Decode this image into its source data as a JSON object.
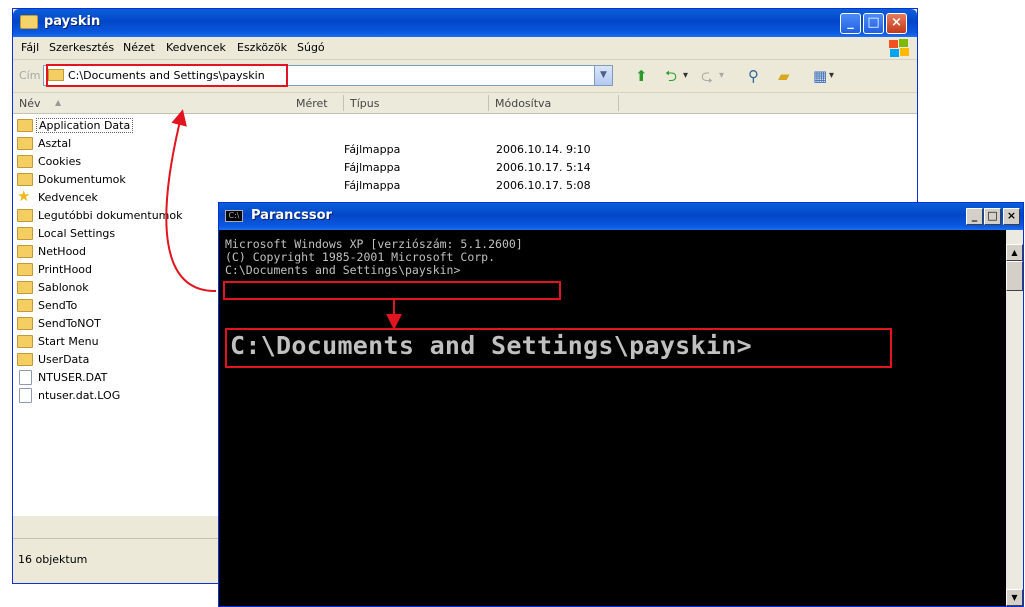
{
  "explorer": {
    "title": "payskin",
    "menu": [
      "Fájl",
      "Szerkesztés",
      "Nézet",
      "Kedvencek",
      "Eszközök",
      "Súgó"
    ],
    "address_label": "Cím",
    "address_value": "C:\\Documents and Settings\\payskin",
    "columns": {
      "name": "Név",
      "size": "Méret",
      "type": "Típus",
      "modified": "Módosítva"
    },
    "files": [
      {
        "name": "Application Data",
        "icon": "folder-icon",
        "type": "Fájlmappa",
        "modified": "2006.10.14. 9:10"
      },
      {
        "name": "Asztal",
        "icon": "folder-icon",
        "type": "Fájlmappa",
        "modified": "2006.10.17. 5:14"
      },
      {
        "name": "Cookies",
        "icon": "folder-icon",
        "type": "Fájlmappa",
        "modified": "2006.10.17. 5:08"
      },
      {
        "name": "Dokumentumok",
        "icon": "folder-icon"
      },
      {
        "name": "Kedvencek",
        "icon": "favorites-folder-icon"
      },
      {
        "name": "Legutóbbi dokumentumok",
        "icon": "folder-icon"
      },
      {
        "name": "Local Settings",
        "icon": "folder-icon"
      },
      {
        "name": "NetHood",
        "icon": "folder-icon"
      },
      {
        "name": "PrintHood",
        "icon": "folder-icon"
      },
      {
        "name": "Sablonok",
        "icon": "folder-icon"
      },
      {
        "name": "SendTo",
        "icon": "folder-icon"
      },
      {
        "name": "SendToNOT",
        "icon": "folder-icon"
      },
      {
        "name": "Start Menu",
        "icon": "folder-icon"
      },
      {
        "name": "UserData",
        "icon": "folder-icon"
      },
      {
        "name": "NTUSER.DAT",
        "icon": "file-icon"
      },
      {
        "name": "ntuser.dat.LOG",
        "icon": "file-icon"
      }
    ],
    "status": "16 objektum"
  },
  "cmd": {
    "title": "Parancssor",
    "lines": [
      "Microsoft Windows XP [verziószám: 5.1.2600]",
      "(C) Copyright 1985-2001 Microsoft Corp.",
      "",
      "C:\\Documents and Settings\\payskin>"
    ],
    "zoom_text": "C:\\Documents and Settings\\payskin>"
  },
  "colors": {
    "highlight": "#e1141f",
    "xp_title": "#0a5fd9"
  }
}
